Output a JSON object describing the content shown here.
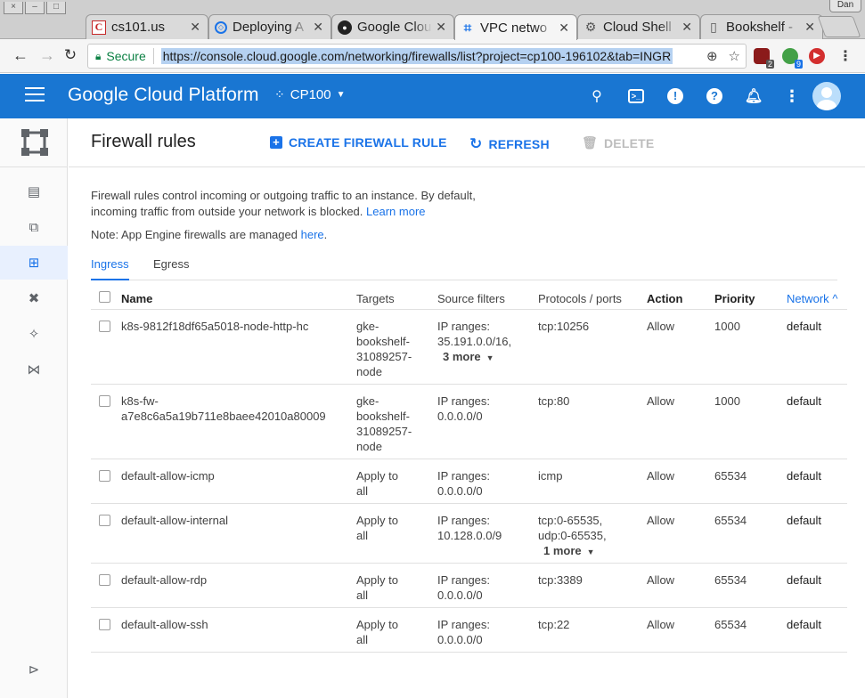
{
  "browser": {
    "tabs": [
      {
        "title": "cs101.us",
        "favicon": "c-letter-icon"
      },
      {
        "title": "Deploying A",
        "favicon": "code-icon"
      },
      {
        "title": "Google Clou",
        "favicon": "github-icon"
      },
      {
        "title": "VPC netwo",
        "favicon": "vpc-icon"
      },
      {
        "title": "Cloud Shell",
        "favicon": "gear-icon"
      },
      {
        "title": "Bookshelf -",
        "favicon": "document-icon"
      }
    ],
    "profile": "Dan",
    "secure_label": "Secure",
    "url": "https://console.cloud.google.com/networking/firewalls/list?project=cp100-196102&tab=INGR",
    "ext_badges": [
      "2",
      "9"
    ]
  },
  "header": {
    "brand": "Google Cloud Platform",
    "project": "CP100"
  },
  "page": {
    "title": "Firewall rules",
    "create_label": "CREATE FIREWALL RULE",
    "refresh_label": "REFRESH",
    "delete_label": "DELETE",
    "desc_line1": "Firewall rules control incoming or outgoing traffic to an instance. By default,",
    "desc_line2": "incoming traffic from outside your network is blocked.",
    "learn_more": "Learn more",
    "note_text": "Note: App Engine firewalls are managed",
    "note_link": "here",
    "tabs": [
      "Ingress",
      "Egress"
    ]
  },
  "table": {
    "columns": [
      "Name",
      "Targets",
      "Source filters",
      "Protocols / ports",
      "Action",
      "Priority",
      "Network"
    ],
    "sort_indicator": "^",
    "rows": [
      {
        "name": [
          "k8s-9812f18df65a5018-node-http-hc"
        ],
        "targets": [
          "gke-",
          "bookshelf-",
          "31089257-",
          "node"
        ],
        "source": [
          "IP ranges:",
          "35.191.0.0/16,"
        ],
        "source_more": "3 more",
        "proto": [
          "tcp:10256"
        ],
        "proto_more": "",
        "action": "Allow",
        "priority": "1000",
        "network": "default"
      },
      {
        "name": [
          "k8s-fw-",
          "a7e8c6a5a19b711e8baee42010a80009"
        ],
        "targets": [
          "gke-",
          "bookshelf-",
          "31089257-",
          "node"
        ],
        "source": [
          "IP ranges:",
          "0.0.0.0/0"
        ],
        "source_more": "",
        "proto": [
          "tcp:80"
        ],
        "proto_more": "",
        "action": "Allow",
        "priority": "1000",
        "network": "default"
      },
      {
        "name": [
          "default-allow-icmp"
        ],
        "targets": [
          "Apply to",
          "all"
        ],
        "source": [
          "IP ranges:",
          "0.0.0.0/0"
        ],
        "source_more": "",
        "proto": [
          "icmp"
        ],
        "proto_more": "",
        "action": "Allow",
        "priority": "65534",
        "network": "default"
      },
      {
        "name": [
          "default-allow-internal"
        ],
        "targets": [
          "Apply to",
          "all"
        ],
        "source": [
          "IP ranges:",
          "10.128.0.0/9"
        ],
        "source_more": "",
        "proto": [
          "tcp:0-65535,",
          "udp:0-65535,"
        ],
        "proto_more": "1 more",
        "action": "Allow",
        "priority": "65534",
        "network": "default"
      },
      {
        "name": [
          "default-allow-rdp"
        ],
        "targets": [
          "Apply to",
          "all"
        ],
        "source": [
          "IP ranges:",
          "0.0.0.0/0"
        ],
        "source_more": "",
        "proto": [
          "tcp:3389"
        ],
        "proto_more": "",
        "action": "Allow",
        "priority": "65534",
        "network": "default"
      },
      {
        "name": [
          "default-allow-ssh"
        ],
        "targets": [
          "Apply to",
          "all"
        ],
        "source": [
          "IP ranges:",
          "0.0.0.0/0"
        ],
        "source_more": "",
        "proto": [
          "tcp:22"
        ],
        "proto_more": "",
        "action": "Allow",
        "priority": "65534",
        "network": "default"
      }
    ]
  },
  "colors": {
    "header_blue": "#1976d2",
    "link_blue": "#1a73e8"
  }
}
